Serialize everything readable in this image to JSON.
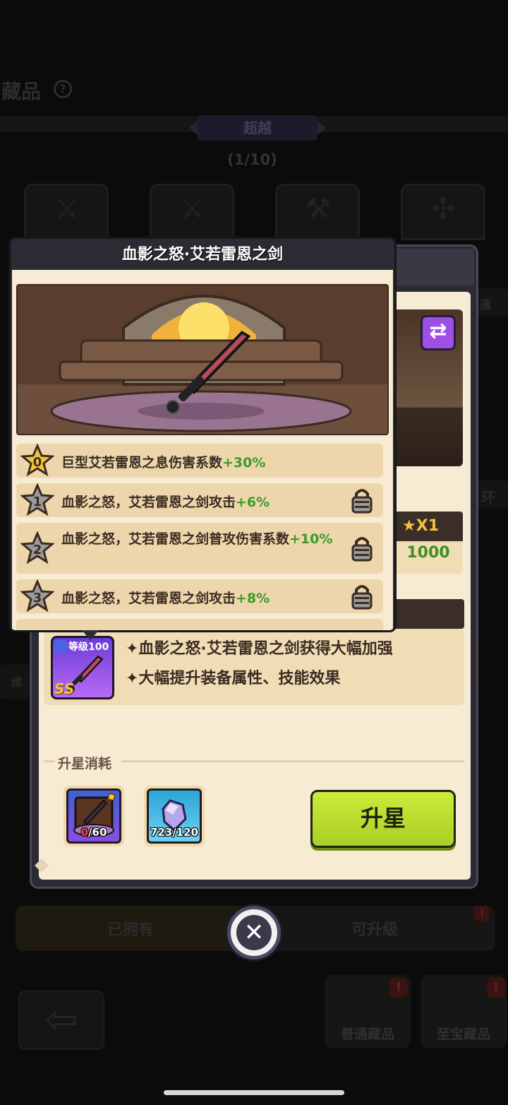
{
  "background": {
    "title": "藏品",
    "help_icon": "question-icon",
    "tier_label": "超越",
    "progress": "(1/10)",
    "tabs": {
      "owned": "已拥有",
      "upgradable": "可升级"
    },
    "nav": {
      "common": "普通藏品",
      "treasure": "至宝藏品"
    },
    "alert_mark": "!",
    "side_text_right_1": "通",
    "side_text_right_2": "环",
    "side_text_left": "维"
  },
  "panel": {
    "cost_box": {
      "star_count": "X1",
      "value": "1000"
    },
    "item": {
      "level": "等级100",
      "grade": "SS"
    },
    "bonus_lines": [
      "✦血影之怒·艾若雷恩之剑获得大幅加强",
      "✦大幅提升装备属性、技能效果"
    ],
    "cost_section_label": "升星消耗",
    "costs": [
      {
        "name": "weapon-shard",
        "have": "0",
        "need": "/60",
        "insufficient": true
      },
      {
        "name": "crystal",
        "have": "723",
        "need": "/120",
        "insufficient": false
      }
    ],
    "upgrade_button": "升星"
  },
  "popup": {
    "title": "血影之怒·艾若雷恩之剑",
    "star_rows": [
      {
        "star": "0",
        "text": "巨型艾若雷恩之息伤害系数",
        "gain": "+30%",
        "unlocked": true
      },
      {
        "star": "1",
        "text": "血影之怒，艾若雷恩之剑攻击",
        "gain": "+6%",
        "unlocked": false
      },
      {
        "star": "2",
        "text": "血影之怒，艾若雷恩之剑普攻伤害系数",
        "gain": "+10%",
        "unlocked": false
      },
      {
        "star": "3",
        "text": "血影之怒，艾若雷恩之剑攻击",
        "gain": "+8%",
        "unlocked": false
      }
    ]
  },
  "close_icon": "close-icon",
  "colors": {
    "accent_green": "#a8d024",
    "gain_green": "#3c9a2a",
    "gold": "#f3c43a",
    "purple": "#9d4fe6"
  }
}
